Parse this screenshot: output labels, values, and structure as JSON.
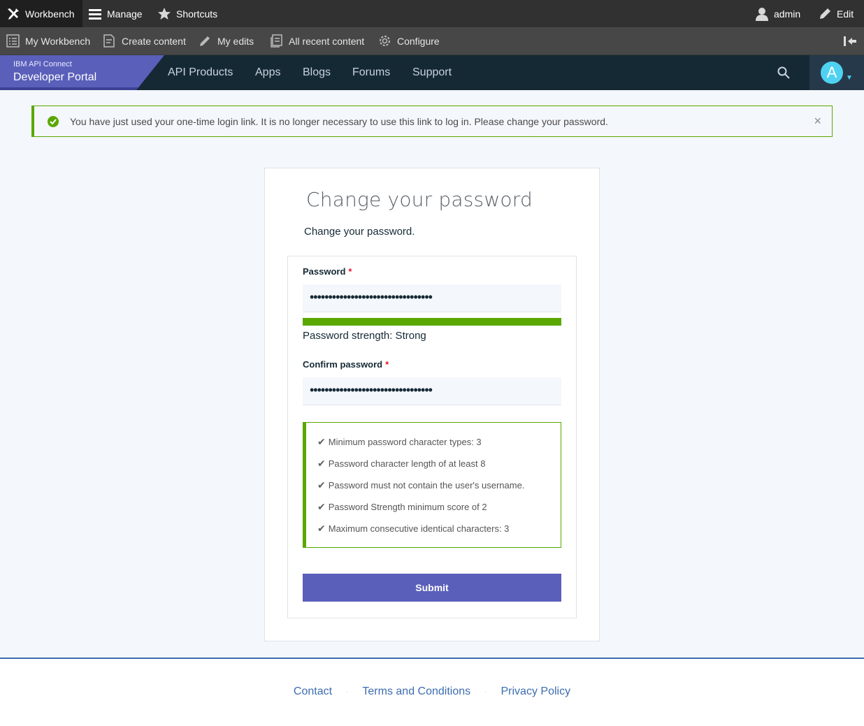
{
  "toolbar": {
    "workbench": "Workbench",
    "manage": "Manage",
    "shortcuts": "Shortcuts",
    "user": "admin",
    "edit": "Edit"
  },
  "tray": {
    "my_workbench": "My Workbench",
    "create_content": "Create content",
    "my_edits": "My edits",
    "all_recent": "All recent content",
    "configure": "Configure"
  },
  "header": {
    "brand_sub": "IBM API Connect",
    "brand_main": "Developer Portal",
    "nav": [
      "API Products",
      "Apps",
      "Blogs",
      "Forums",
      "Support"
    ],
    "avatar_letter": "A"
  },
  "message": {
    "text": "You have just used your one-time login link. It is no longer necessary to use this link to log in. Please change your password.",
    "close": "×"
  },
  "form": {
    "title": "Change your password",
    "intro": "Change your password.",
    "password_label": "Password",
    "confirm_label": "Confirm password",
    "required_mark": "*",
    "password_value": "•••••••••••••••••••••••••••••••••",
    "confirm_value": "•••••••••••••••••••••••••••••••••",
    "strength_fraction": 1.0,
    "strength_text": "Password strength: Strong",
    "rules": [
      "Minimum password character types: 3",
      "Password character length of at least 8",
      "Password must not contain the user's username.",
      "Password Strength minimum score of 2",
      "Maximum consecutive identical characters: 3"
    ],
    "submit": "Submit"
  },
  "footer": {
    "links": [
      "Contact",
      "Terms and Conditions",
      "Privacy Policy"
    ],
    "separator": "·"
  },
  "colors": {
    "toolbar_bg": "#313131",
    "header_bg": "#152935",
    "brand_purple": "#5a5fba",
    "success_green": "#5aa700",
    "avatar_cyan": "#4fd1f2",
    "link_blue": "#3c6db0"
  }
}
